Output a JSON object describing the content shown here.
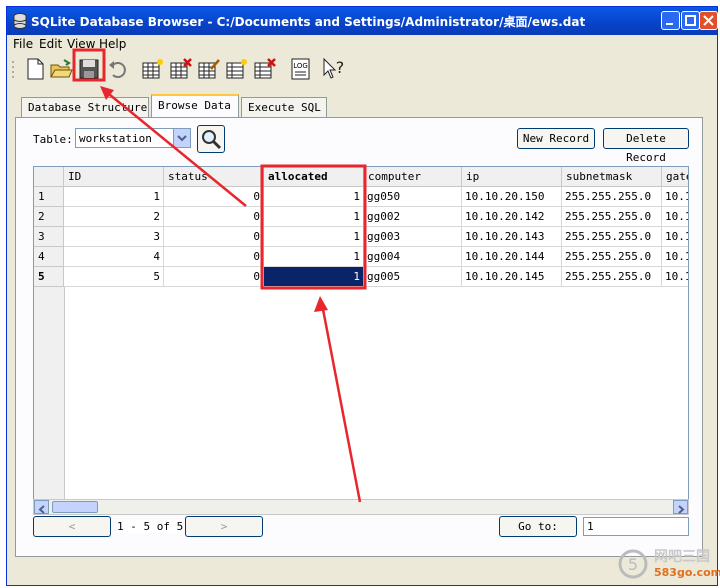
{
  "window": {
    "title": "SQLite Database Browser - C:/Documents and Settings/Administrator/桌面/ews.dat"
  },
  "menu": [
    "File",
    "Edit",
    "View",
    "Help"
  ],
  "toolbar_icons": [
    "new-database-icon",
    "open-database-icon",
    "save-icon",
    "undo-icon",
    "create-table-icon",
    "delete-table-icon",
    "modify-table-icon",
    "create-index-icon",
    "delete-index-icon",
    "log-icon",
    "whats-this-icon"
  ],
  "toolbar_log_label": "LOG",
  "tabs": [
    {
      "label": "Database Structure",
      "active": false
    },
    {
      "label": "Browse Data",
      "active": true
    },
    {
      "label": "Execute SQL",
      "active": false
    }
  ],
  "browse": {
    "table_label": "Table:",
    "table_value": "workstation",
    "new_record": "New Record",
    "delete_record": "Delete Record"
  },
  "grid": {
    "columns": [
      "ID",
      "status",
      "allocated",
      "computer",
      "ip",
      "subnetmask",
      "gate"
    ],
    "rows": [
      {
        "row": "1",
        "cells": [
          "1",
          "0",
          "1",
          "gg050",
          "10.10.20.150",
          "255.255.255.0",
          "10.1"
        ]
      },
      {
        "row": "2",
        "cells": [
          "2",
          "0",
          "1",
          "gg002",
          "10.10.20.142",
          "255.255.255.0",
          "10.1"
        ]
      },
      {
        "row": "3",
        "cells": [
          "3",
          "0",
          "1",
          "gg003",
          "10.10.20.143",
          "255.255.255.0",
          "10.1"
        ]
      },
      {
        "row": "4",
        "cells": [
          "4",
          "0",
          "1",
          "gg004",
          "10.10.20.144",
          "255.255.255.0",
          "10.1"
        ]
      },
      {
        "row": "5",
        "cells": [
          "5",
          "0",
          "1",
          "gg005",
          "10.10.20.145",
          "255.255.255.0",
          "10.1"
        ]
      }
    ],
    "selected_row": 5,
    "selected_column": "allocated"
  },
  "footer": {
    "prev": "<",
    "next": ">",
    "range": "1 - 5 of 5",
    "goto_label": "Go to:",
    "goto_value": "1"
  },
  "watermark": {
    "line1": "网吧三国",
    "line2": "583go.com"
  },
  "colors": {
    "annotation": "#e8262d",
    "selection": "#0a246a"
  }
}
